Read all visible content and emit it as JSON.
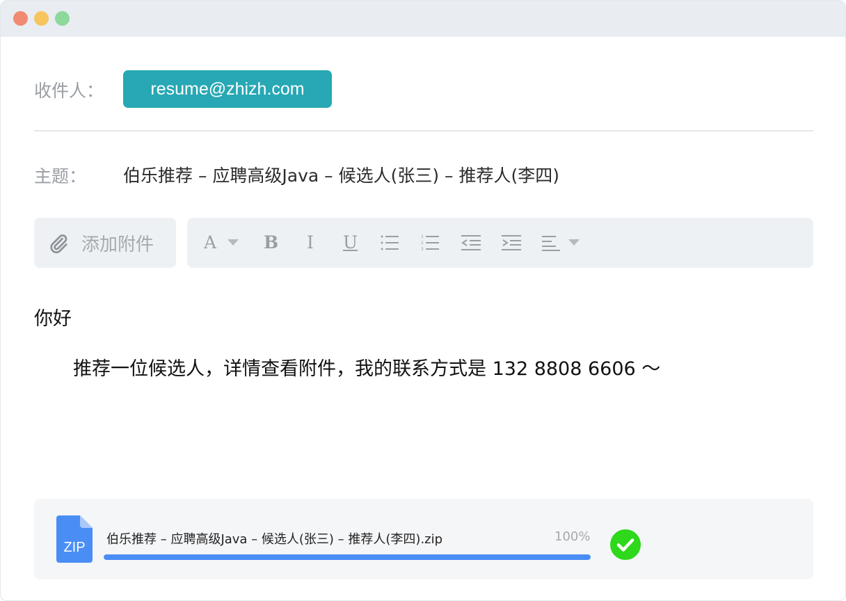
{
  "compose": {
    "recipient_label": "收件人：",
    "recipient_value": "resume@zhizh.com",
    "subject_label": "主题：",
    "subject_value": "伯乐推荐 – 应聘高级Java – 候选人(张三) – 推荐人(李四)",
    "attach_button_label": "添加附件"
  },
  "toolbar": {
    "font_label": "A",
    "bold_label": "B",
    "italic_label": "I",
    "underline_label": "U",
    "items": [
      "font-color",
      "bold",
      "italic",
      "underline",
      "bullet-list",
      "numbered-list",
      "outdent",
      "indent",
      "align"
    ]
  },
  "body": {
    "greeting": "你好",
    "line": "推荐一位候选人，详情查看附件，我的联系方式是 132 8808 6606 ～"
  },
  "attachment": {
    "icon_text": "ZIP",
    "file_name": "伯乐推荐 – 应聘高级Java – 候选人(张三) – 推荐人(李四).zip",
    "progress_text": "100%",
    "progress_fraction": 1.0,
    "status": "complete"
  },
  "colors": {
    "accent_teal": "#27a8b4",
    "progress_blue": "#4a8ef5",
    "success_green": "#2ed81a",
    "zip_blue": "#4a8ef5"
  }
}
